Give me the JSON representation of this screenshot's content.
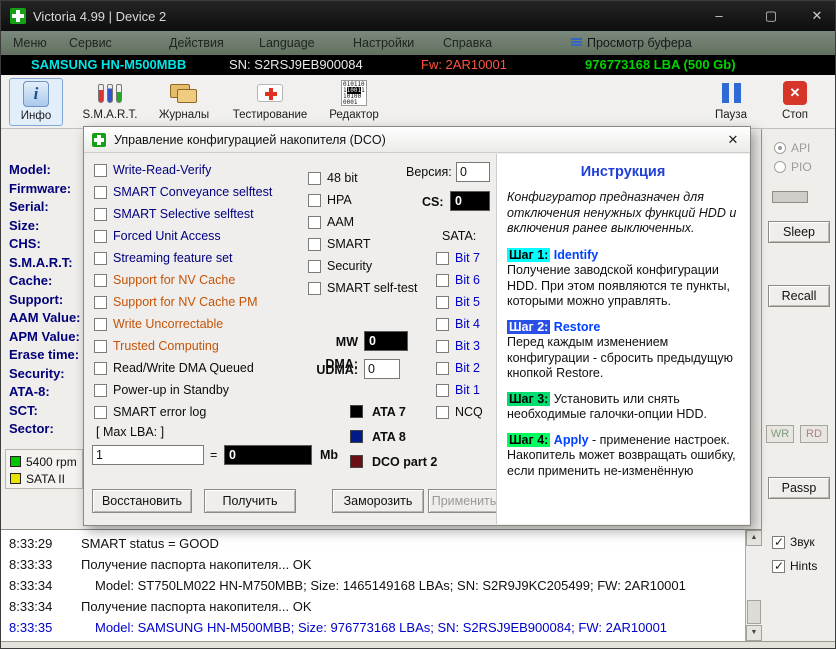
{
  "window": {
    "title": "Victoria 4.99 | Device 2",
    "minimize": "–",
    "maximize": "▢",
    "close": "✕"
  },
  "menu": {
    "items": [
      "Меню",
      "Сервис",
      "Действия",
      "Language",
      "Настройки",
      "Справка"
    ],
    "buffer_view": "Просмотр буфера"
  },
  "device_bar": {
    "model": "SAMSUNG HN-M500MBB",
    "sn": "SN: S2RSJ9EB900084",
    "fw": "Fw: 2AR10001",
    "lba": "976773168 LBA (500 Gb)"
  },
  "toolbar": {
    "info": "Инфо",
    "smart": "S.M.A.R.T.",
    "logs": "Журналы",
    "test": "Тестирование",
    "editor": "Редактор",
    "pause": "Пауза",
    "stop": "Стоп"
  },
  "info_panel": {
    "labels": [
      "Model:",
      "Firmware:",
      "Serial:",
      "Size:",
      "CHS:",
      "S.M.A.R.T:",
      "Cache:",
      "Support:",
      "AAM Value:",
      "APM Value:",
      "Erase time:",
      "Security:",
      "ATA-8:",
      "SCT:",
      "Sector:"
    ]
  },
  "legend": {
    "rpm": "5400 rpm",
    "sata": "SATA II"
  },
  "dialog": {
    "title": "Управление конфигурацией накопителя (DCO)",
    "close": "✕",
    "checks": [
      "Write-Read-Verify",
      "SMART Conveyance selftest",
      "SMART Selective selftest",
      "Forced Unit Access",
      "Streaming feature set",
      "Support for NV Cache",
      "Support for NV Cache PM",
      "Write Uncorrectable",
      "Trusted Computing",
      "Read/Write DMA Queued",
      "Power-up in Standby",
      "SMART error log"
    ],
    "checks_mid": [
      "48 bit",
      "HPA",
      "AAM",
      "SMART",
      "Security",
      "SMART self-test"
    ],
    "version_label": "Версия:",
    "version_value": "0",
    "cs_label": "CS:",
    "cs_value": "0",
    "sata_label": "SATA:",
    "sata_bits": [
      "Bit 7",
      "Bit 6",
      "Bit 5",
      "Bit 4",
      "Bit 3",
      "Bit 2",
      "Bit 1",
      "NCQ"
    ],
    "mwdma_label": "MW DMA:",
    "mwdma_value": "0",
    "udma_label": "UDMA:",
    "udma_value": "0",
    "ata7": "ATA 7",
    "ata8": "ATA 8",
    "dco2": "DCO part 2",
    "maxlba_label": "[ Max LBA: ]",
    "maxlba_value": "1",
    "equals": "=",
    "mb_value": "0",
    "mb_unit": "Mb",
    "btn_restore": "Восстановить",
    "btn_get": "Получить",
    "btn_freeze": "Заморозить",
    "btn_apply": "Применить",
    "instruction": {
      "title": "Инструкция",
      "intro": "Конфигуратор предназначен для отключения ненужных функций HDD и включения ранее выключенных.",
      "step1_tag": "Шаг 1:",
      "step1_cmd": "Identify",
      "step1_text": "Получение заводской конфигурации HDD. При этом появляются те пункты, которыми можно управлять.",
      "step2_tag": "Шаг 2:",
      "step2_cmd": "Restore",
      "step2_text": "Перед каждым изменением конфигурации - сбросить предыдущую кнопкой Restore.",
      "step3_tag": "Шаг 3:",
      "step3_text": "Установить или снять необходимые галочки-опции HDD.",
      "step4_tag": "Шаг 4:",
      "step4_cmd": "Apply",
      "step4_text": "- применение настроек. Накопитель может возвращать ошибку, если применить не-изменённую"
    }
  },
  "right_panel": {
    "api": "API",
    "pio": "PIO",
    "sleep": "Sleep",
    "recall": "Recall",
    "wr": "WR",
    "rd": "RD",
    "passp": "Passp",
    "sound": "Звук",
    "hints": "Hints"
  },
  "log": {
    "rows": [
      {
        "time": "8:33:29",
        "text": "SMART status = GOOD"
      },
      {
        "time": "8:33:33",
        "text": "Получение паспорта накопителя... OK"
      },
      {
        "time": "8:33:34",
        "text": "Model: ST750LM022 HN-M750MBB; Size: 1465149168 LBAs; SN: S2R9J9KC205499; FW: 2AR10001"
      },
      {
        "time": "8:33:34",
        "text": "Получение паспорта накопителя... OK"
      },
      {
        "time": "8:33:35",
        "text": "Model: SAMSUNG HN-M500MBB; Size: 976773168 LBAs; SN: S2RSJ9EB900084; FW: 2AR10001"
      }
    ]
  }
}
